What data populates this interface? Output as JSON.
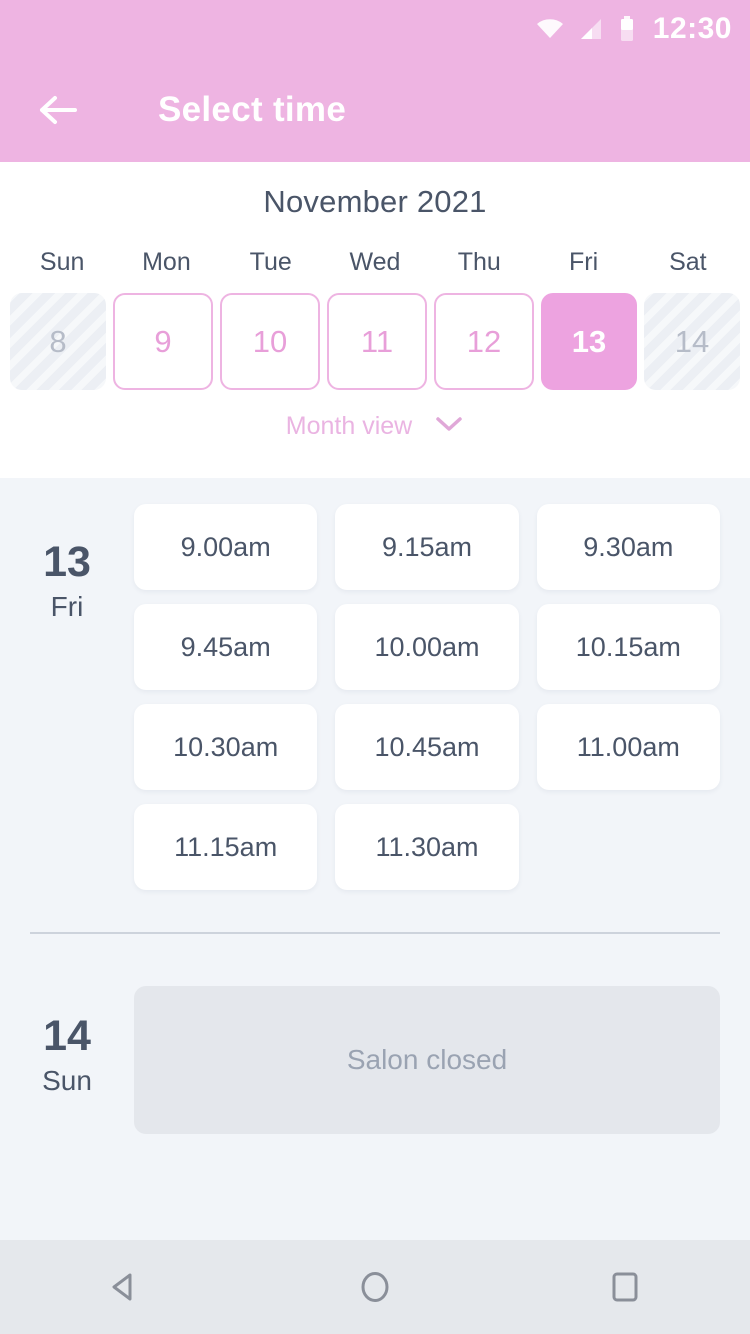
{
  "status_bar": {
    "time": "12:30",
    "icons": [
      "wifi-icon",
      "signal-icon",
      "battery-icon"
    ]
  },
  "app_bar": {
    "title": "Select time",
    "back_icon": "back-arrow-icon"
  },
  "calendar": {
    "month_title": "November 2021",
    "weekdays": [
      "Sun",
      "Mon",
      "Tue",
      "Wed",
      "Thu",
      "Fri",
      "Sat"
    ],
    "dates": [
      {
        "day": "8",
        "state": "disabled"
      },
      {
        "day": "9",
        "state": "available"
      },
      {
        "day": "10",
        "state": "available"
      },
      {
        "day": "11",
        "state": "available"
      },
      {
        "day": "12",
        "state": "available"
      },
      {
        "day": "13",
        "state": "selected"
      },
      {
        "day": "14",
        "state": "disabled"
      }
    ],
    "month_view_label": "Month view",
    "month_view_icon": "chevron-down-icon"
  },
  "days": [
    {
      "date_number": "13",
      "weekday": "Fri",
      "slots": [
        "9.00am",
        "9.15am",
        "9.30am",
        "9.45am",
        "10.00am",
        "10.15am",
        "10.30am",
        "10.45am",
        "11.00am",
        "11.15am",
        "11.30am"
      ],
      "closed_message": null
    },
    {
      "date_number": "14",
      "weekday": "Sun",
      "slots": [],
      "closed_message": "Salon closed"
    }
  ],
  "nav_bar": {
    "back": "nav-back-icon",
    "home": "nav-home-icon",
    "recents": "nav-recents-icon"
  },
  "colors": {
    "accent_pink": "#eeb4e2",
    "selected_pink": "#eda3e0",
    "text_dark": "#4a5568",
    "page_bg": "#f2f5f9",
    "closed_bg": "#e4e7ec"
  }
}
